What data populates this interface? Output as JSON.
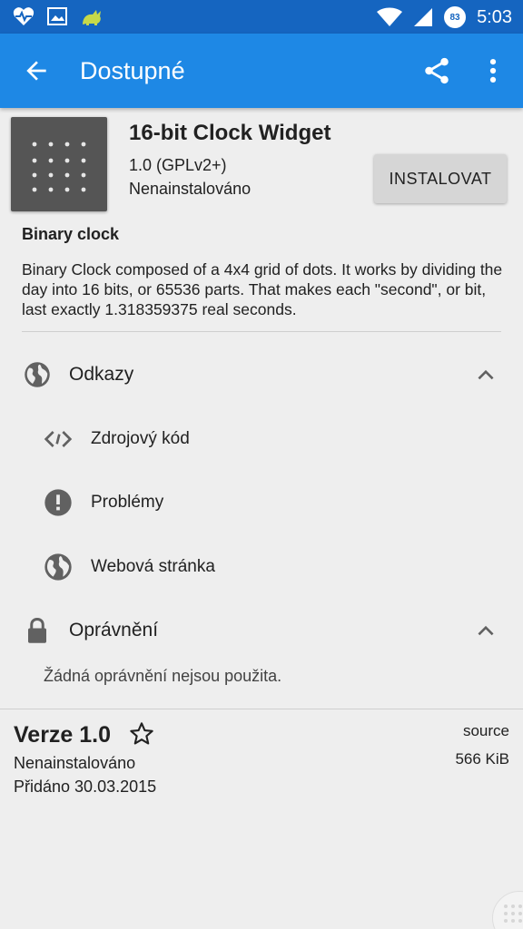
{
  "status_bar": {
    "time": "5:03",
    "battery_level": "83",
    "icons": [
      "heart-pulse-icon",
      "image-icon",
      "cat-icon",
      "wifi-icon",
      "signal-icon",
      "battery-icon"
    ]
  },
  "app_bar": {
    "title": "Dostupné",
    "color": "#1e88e5",
    "status_color": "#1565c0"
  },
  "app": {
    "name": "16-bit Clock Widget",
    "version_license": "1.0 (GPLv2+)",
    "install_status": "Nenainstalováno",
    "install_button": "INSTALOVAT",
    "summary": "Binary clock",
    "description": "Binary Clock composed of a 4x4 grid of dots. It works by dividing the day into 16 bits, or 65536 parts. That makes each \"second\", or bit, last exactly 1.318359375 real seconds."
  },
  "links": {
    "title": "Odkazy",
    "items": [
      {
        "label": "Zdrojový kód",
        "icon": "code-icon"
      },
      {
        "label": "Problémy",
        "icon": "alert-icon"
      },
      {
        "label": "Webová stránka",
        "icon": "globe-icon"
      }
    ]
  },
  "permissions": {
    "title": "Oprávnění",
    "empty_text": "Žádná oprávnění nejsou použita."
  },
  "version": {
    "title": "Verze 1.0",
    "status": "Nenainstalováno",
    "added": "Přidáno 30.03.2015",
    "source": "source",
    "size": "566 KiB"
  }
}
